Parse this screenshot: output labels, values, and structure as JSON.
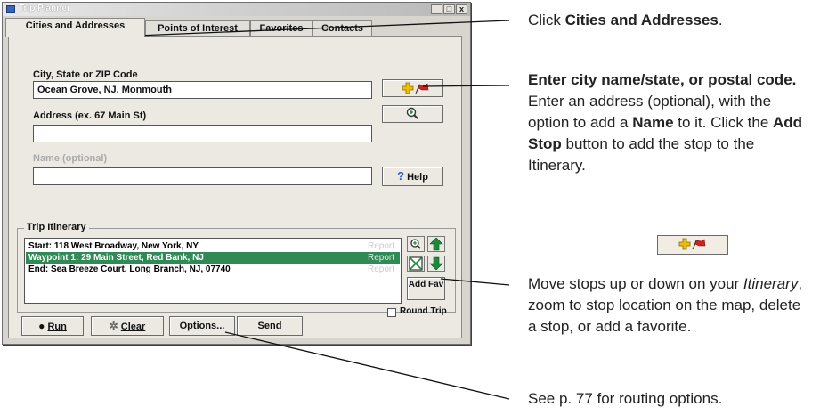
{
  "window": {
    "title": "Trip Planner",
    "controls": {
      "minimize": "_",
      "maximize": "□",
      "close": "x"
    }
  },
  "tabs": [
    "Cities and Addresses",
    "Points of Interest",
    "Favorites",
    "Contacts"
  ],
  "form": {
    "city_label": "City, State or ZIP Code",
    "city_value": "Ocean Grove, NJ, Monmouth",
    "address_label": "Address (ex. 67 Main St)",
    "address_value": "",
    "name_label": "Name (optional)",
    "name_value": "",
    "help_label": "Help"
  },
  "itinerary": {
    "label": "Trip Itinerary",
    "rows": [
      {
        "text": "Start: 118 West Broadway, New York, NY",
        "report": "Report"
      },
      {
        "text": "Waypoint 1: 29 Main Street, Red Bank, NJ",
        "report": "Report"
      },
      {
        "text": "End: Sea Breeze Court, Long Branch, NJ, 07740",
        "report": "Report"
      }
    ],
    "add_fav_label": "Add Fav",
    "round_trip_label": "Round Trip",
    "round_trip_checked": false
  },
  "bottom_buttons": {
    "run": "Run",
    "clear": "Clear",
    "options": "Options...",
    "send": "Send"
  },
  "annotations": {
    "a1_pre": "Click ",
    "a1_bold": "Cities and Addresses",
    "a1_post": ".",
    "a2_bold": "Enter city name/state, or postal code.",
    "a2_p1": " Enter an address (optional), with the option to add a ",
    "a2_name": "Name",
    "a2_p2": " to it. Click the ",
    "a2_addstop": "Add Stop",
    "a2_p3": " button to add the stop to the Itinerary.",
    "a3_pre": "Move stops up or down on your ",
    "a3_italic": "Itinerary",
    "a3_post": ", zoom to stop location on the map, delete a stop, or add a favorite.",
    "a4": "See p.  77 for routing options."
  },
  "colors": {
    "selected_row": "#2f8a55",
    "flag_red": "#d42020",
    "plus_yellow": "#f0c000",
    "arrow_green": "#1c8a3a",
    "help_blue": "#2a5bbf"
  }
}
